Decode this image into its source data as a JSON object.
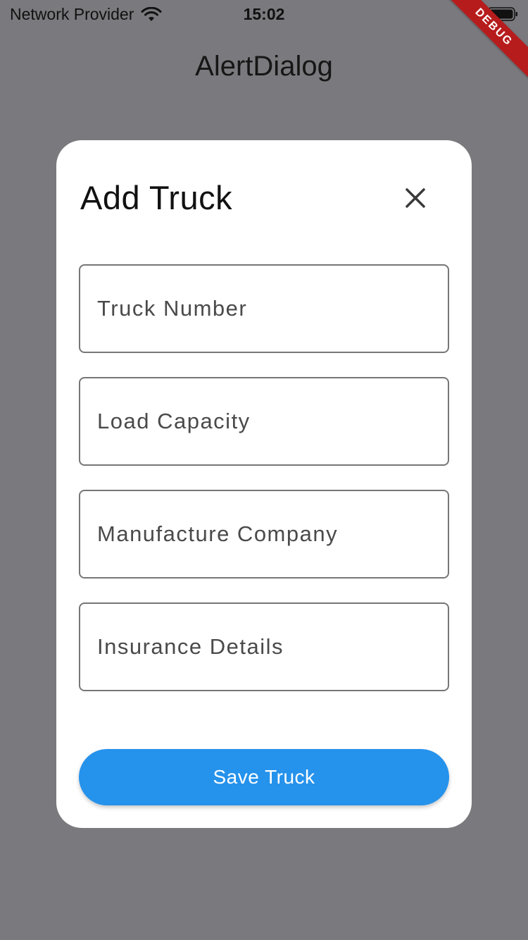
{
  "status_bar": {
    "carrier": "Network Provider",
    "time": "15:02",
    "wifi_icon": "wifi-icon",
    "battery_icon": "battery-icon"
  },
  "debug_banner": "DEBUG",
  "app_bar": {
    "title": "AlertDialog"
  },
  "dialog": {
    "title": "Add Truck",
    "close_icon": "close-icon",
    "fields": [
      {
        "placeholder": "Truck Number",
        "value": ""
      },
      {
        "placeholder": "Load Capacity",
        "value": ""
      },
      {
        "placeholder": "Manufacture Company",
        "value": ""
      },
      {
        "placeholder": "Insurance Details",
        "value": ""
      }
    ],
    "save_label": "Save Truck"
  },
  "colors": {
    "overlay_background": "#7a797d",
    "dialog_background": "#ffffff",
    "primary_button": "#2592ec",
    "field_border": "#767676",
    "debug_ribbon": "#b71c1c"
  }
}
